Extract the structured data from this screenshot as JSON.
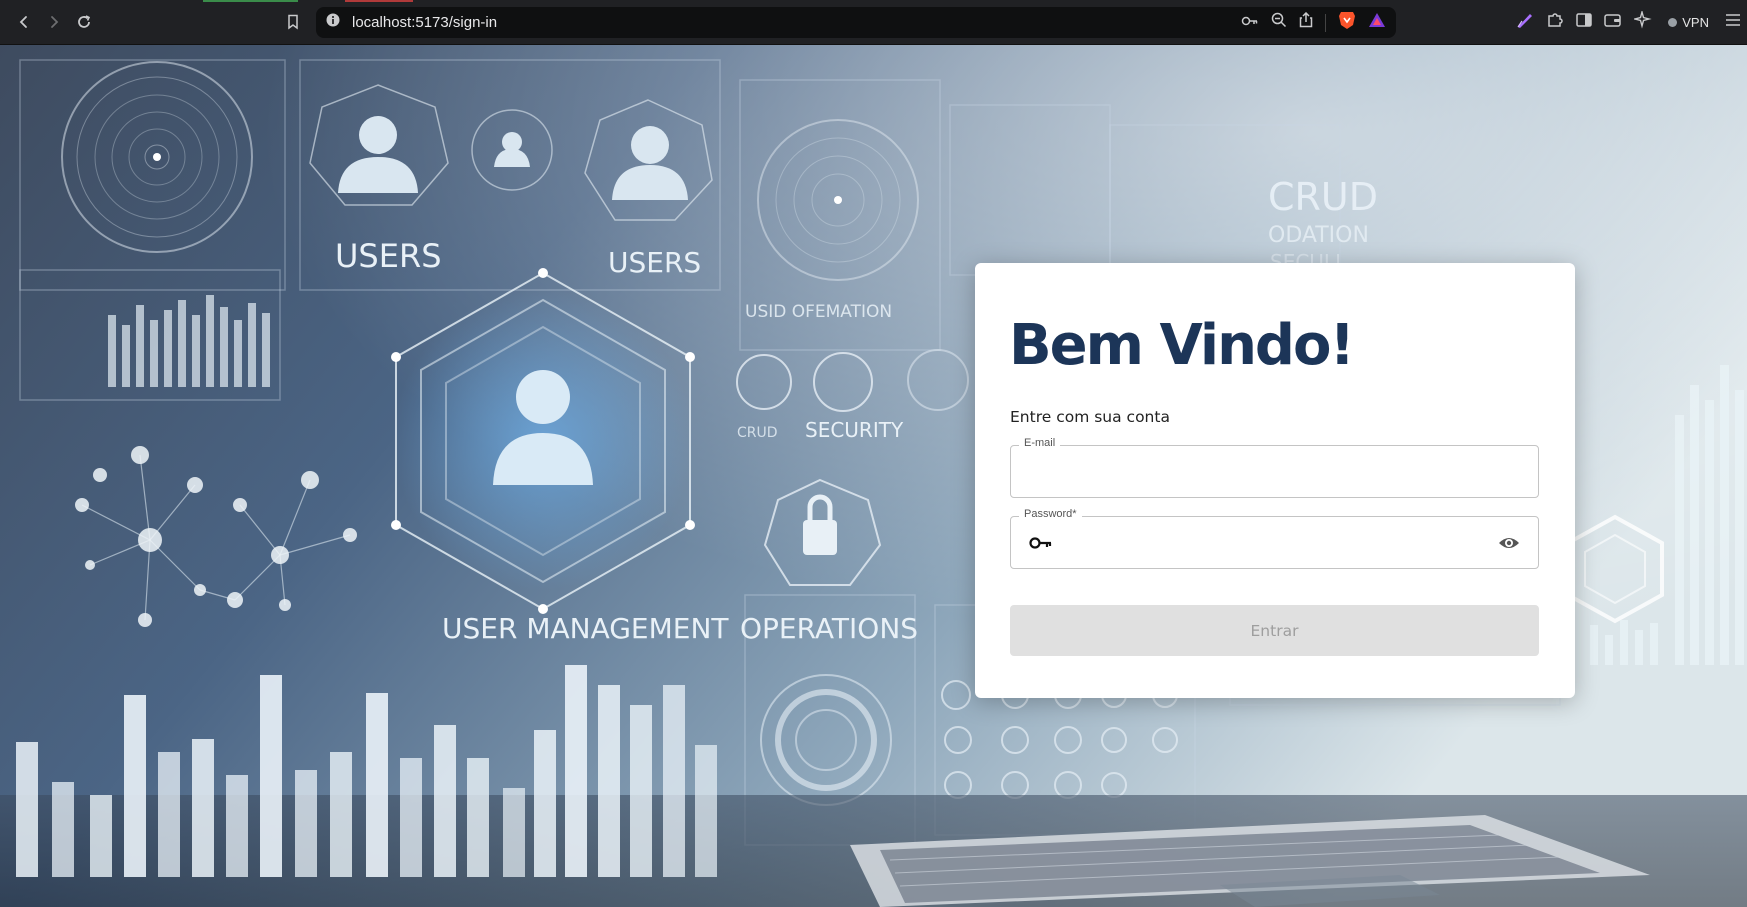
{
  "browser": {
    "url": "localhost:5173/sign-in",
    "vpn_label": "VPN",
    "icons": {
      "back": "back-arrow-icon",
      "forward": "forward-arrow-icon",
      "reload": "reload-icon",
      "bookmark": "bookmark-icon",
      "site_info": "site-info-icon",
      "password_manager": "key-icon",
      "zoom": "zoom-out-icon",
      "share": "share-icon",
      "brave_shields": "brave-lion-icon",
      "brave_rewards": "triangle-icon",
      "leo": "leo-ai-icon",
      "extensions": "puzzle-icon",
      "sidebar": "sidebar-icon",
      "wallet": "wallet-icon",
      "ai_sparkle": "sparkle-icon",
      "menu": "hamburger-menu-icon"
    }
  },
  "background": {
    "labels": {
      "users_left": "USERS",
      "users_right": "USERS",
      "user_management": "USER MANAGEMENT",
      "operations": "OPERATIONS",
      "security": "SECURITY",
      "crud": "CRUD",
      "usid_operation": "USID OFEMATION",
      "odation": "ODATION",
      "seculi": "SECULI",
      "crud_small": "CRUD"
    }
  },
  "login": {
    "title": "Bem Vindo!",
    "subtitle": "Entre com sua conta",
    "email_label": "E-mail",
    "email_value": "",
    "password_label": "Password*",
    "password_value": "",
    "submit_label": "Entrar",
    "submit_disabled": true
  },
  "colors": {
    "title": "#1c3558",
    "button_bg": "#e0e0e0",
    "button_text": "#9e9e9e"
  }
}
